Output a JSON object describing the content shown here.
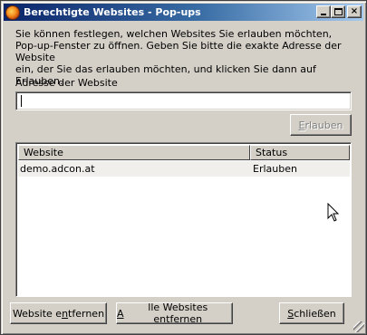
{
  "window": {
    "title": "Berechtigte Websites - Pop-ups",
    "app_icon": "firefox-icon",
    "controls": {
      "minimize_icon": "minimize-icon",
      "maximize_icon": "maximize-icon",
      "close_icon": "close-icon",
      "close_glyph": "×"
    }
  },
  "intro": {
    "line1": "Sie können festlegen, welchen Websites Sie erlauben möchten,",
    "line2": "Pop-up-Fenster zu öffnen. Geben Sie bitte die exakte Adresse der Website",
    "line3": "ein, der Sie das erlauben möchten, und klicken Sie dann auf Erlauben."
  },
  "address": {
    "label": "Adresse der Website",
    "value": "",
    "placeholder": ""
  },
  "allow_button": {
    "accesskey": "E",
    "rest": "rlauben",
    "enabled": false
  },
  "table": {
    "columns": [
      "Website",
      "Status"
    ],
    "rows": [
      {
        "website": "demo.adcon.at",
        "status": "Erlauben"
      }
    ]
  },
  "buttons": {
    "remove": {
      "before": "Website e",
      "accesskey": "n",
      "after": "tfernen"
    },
    "remove_all": {
      "before": "",
      "accesskey": "A",
      "after": "lle Websites entfernen"
    },
    "close": {
      "before": "",
      "accesskey": "S",
      "after": "chließen"
    }
  },
  "colors": {
    "dialog_bg": "#d4d0c8",
    "titlebar_start": "#0a246a",
    "titlebar_end": "#a6caf0",
    "disabled_text": "#808080"
  }
}
